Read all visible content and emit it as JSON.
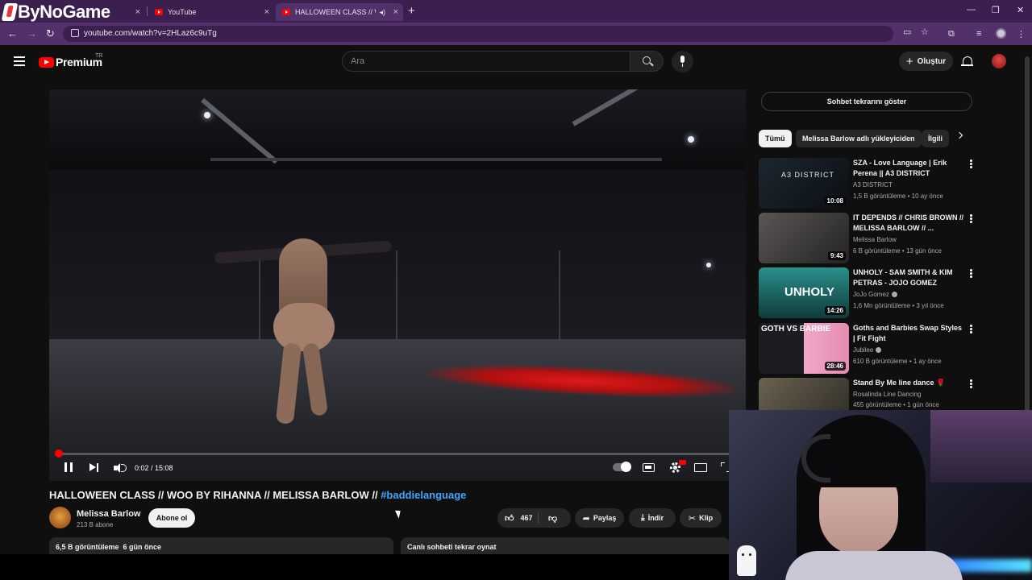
{
  "browser": {
    "brand_text": "ByNoGame",
    "tabs": [
      {
        "label": "",
        "active": false
      },
      {
        "label": "YouTube",
        "active": false
      },
      {
        "label": "HALLOWEEN CLASS // WOO",
        "active": true
      }
    ],
    "new_tab": "+",
    "url": "youtube.com/watch?v=2HLaz6c9uTg"
  },
  "header": {
    "logo_text": "Premium",
    "region": "TR",
    "search_placeholder": "Ara",
    "create_label": "Oluştur"
  },
  "player": {
    "current_time": "0:02",
    "duration": "15:08",
    "time_display": "0:02 / 15:08",
    "progress_fraction": 0.002,
    "progress_color": "#ff0000"
  },
  "video": {
    "title_main": "HALLOWEEN CLASS // WOO BY RIHANNA // MELISSA BARLOW //",
    "title_hashtag": "#baddielanguage",
    "channel_name": "Melissa Barlow",
    "subscribers": "213 B abone",
    "subscribe_label": "Abone ol",
    "likes": "467",
    "share_label": "Paylaş",
    "download_label": "İndir",
    "clip_label": "Klip",
    "views_date": "6,5 B görüntüleme  6 gün önce",
    "live_chat_replay": "Canlı sohbeti tekrar oynat"
  },
  "sidebar": {
    "chat_replay_button": "Sohbet tekrarını göster",
    "chips": [
      "Tümü",
      "Melissa Barlow adlı yükleyiciden",
      "İlgili"
    ],
    "recommendations": [
      {
        "title": "SZA - Love Language | Erik Perena || A3 DISTRICT",
        "channel": "A3 DISTRICT",
        "meta": "1,5 B görüntüleme • 10 ay önce",
        "duration": "10:08",
        "thumb_text": "A3 DISTRICT"
      },
      {
        "title": "IT DEPENDS // CHRIS BROWN // MELISSA BARLOW // ...",
        "channel": "Melissa Barlow",
        "meta": "6 B görüntüleme • 13 gün önce",
        "duration": "9:43",
        "thumb_text": ""
      },
      {
        "title": "UNHOLY - SAM SMITH & KIM PETRAS - JOJO GOMEZ DANC...",
        "channel": "JoJo Gomez",
        "meta": "1,6 Mn görüntüleme • 3 yıl önce",
        "duration": "14:26",
        "thumb_text": "UNHOLY"
      },
      {
        "title": "Goths and Barbies Swap Styles | Fit Fight",
        "channel": "Jubilee",
        "meta": "610 B görüntüleme • 1 ay önce",
        "duration": "28:46",
        "thumb_text": "GOTH VS BARBIE"
      },
      {
        "title": "Stand By Me line dance 🌹",
        "channel": "Rosalinda Line Dancing",
        "meta": "455 görüntüleme • 1 gün önce",
        "duration": "",
        "thumb_text": ""
      }
    ]
  },
  "colors": {
    "accent_red": "#ff0000",
    "hashtag_blue": "#3ea6ff",
    "browser_frame": "#52306a"
  }
}
